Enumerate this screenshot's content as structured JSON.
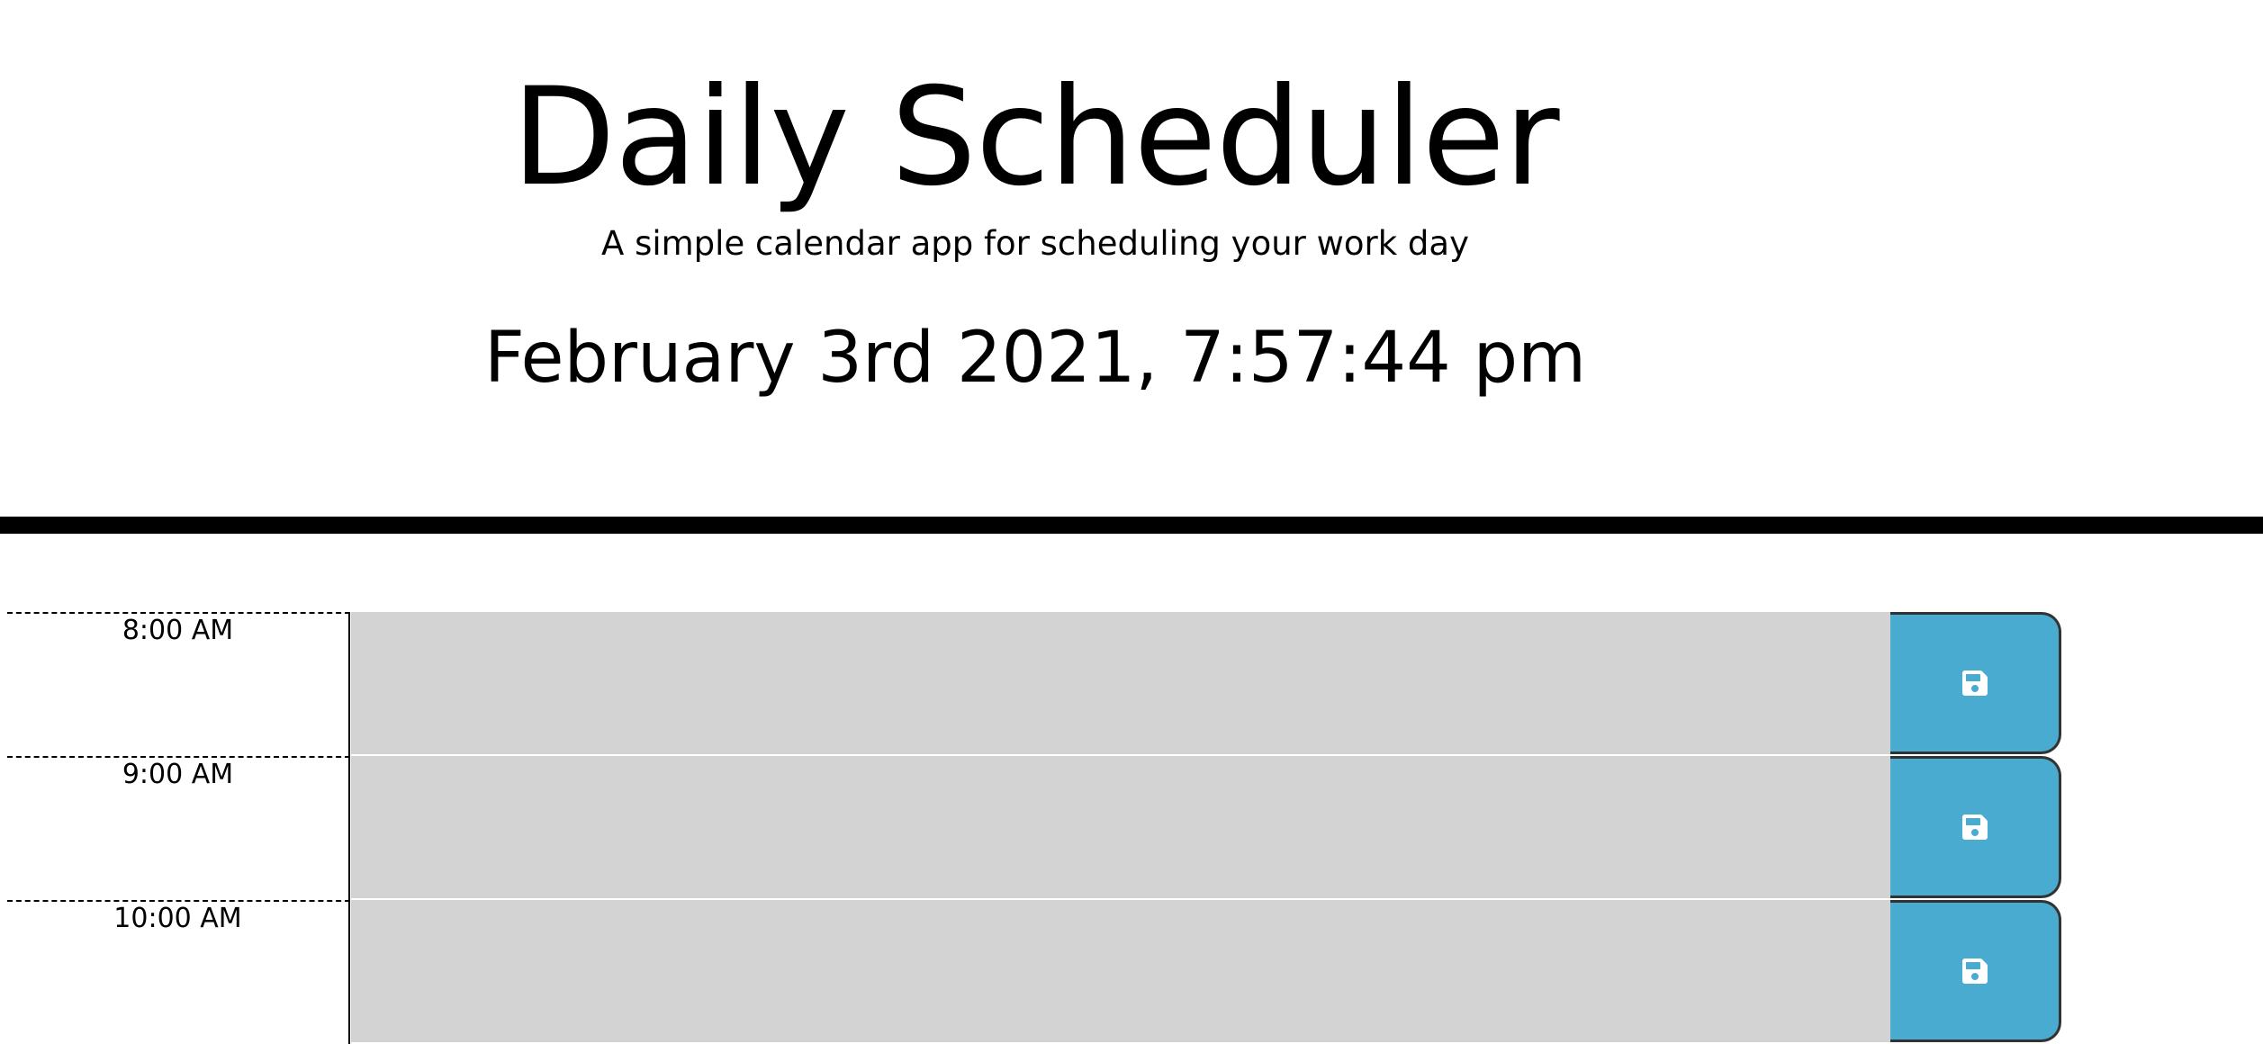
{
  "header": {
    "title": "Daily Scheduler",
    "subtitle": "A simple calendar app for scheduling your work day",
    "current_day": "February 3rd 2021, 7:57:44 pm"
  },
  "time_blocks": [
    {
      "hour": "8:00 AM",
      "text": "",
      "icon": "save-icon"
    },
    {
      "hour": "9:00 AM",
      "text": "",
      "icon": "save-icon"
    },
    {
      "hour": "10:00 AM",
      "text": "",
      "icon": "save-icon"
    }
  ],
  "colors": {
    "past": "#d3d3d3",
    "save_button": "#4aabd1",
    "rule": "#000000"
  }
}
